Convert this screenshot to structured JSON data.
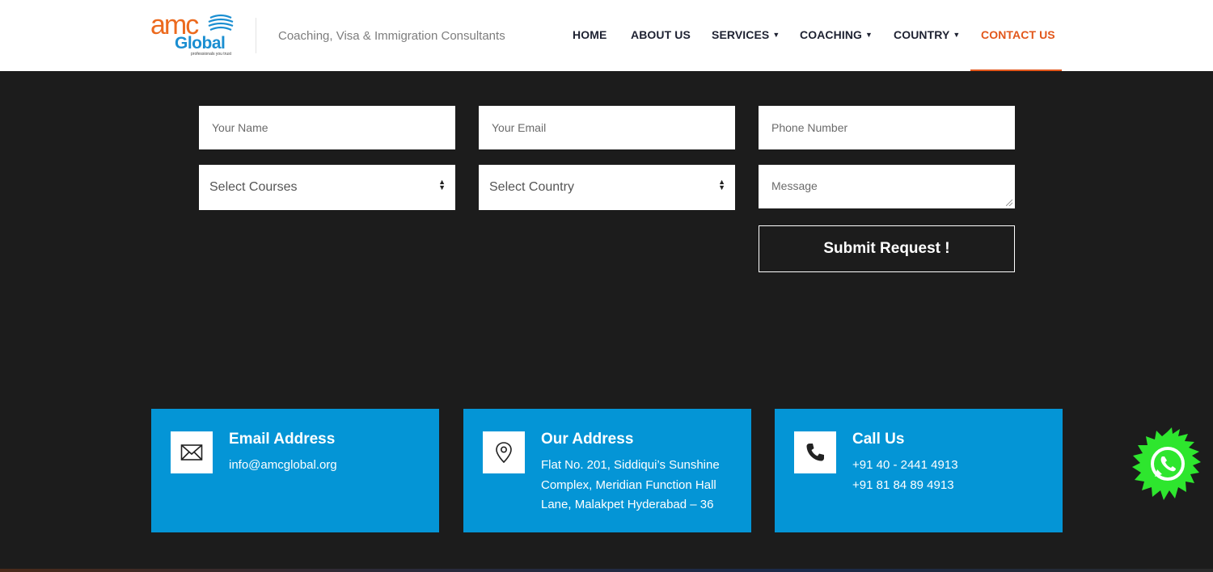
{
  "header": {
    "logo": {
      "brand_top": "amc",
      "brand_bottom": "Global",
      "tagline_small": "professionals you trust"
    },
    "tagline": "Coaching, Visa & Immigration Consultants",
    "nav": [
      {
        "label": "HOME",
        "dropdown": false,
        "active": false
      },
      {
        "label": "ABOUT US",
        "dropdown": false,
        "active": false
      },
      {
        "label": "SERVICES",
        "dropdown": true,
        "active": false
      },
      {
        "label": "COACHING",
        "dropdown": true,
        "active": false
      },
      {
        "label": "COUNTRY",
        "dropdown": true,
        "active": false
      },
      {
        "label": "CONTACT US",
        "dropdown": false,
        "active": true
      }
    ]
  },
  "form": {
    "name_placeholder": "Your Name",
    "email_placeholder": "Your Email",
    "phone_placeholder": "Phone Number",
    "courses_selected": "Select Courses",
    "country_selected": "Select Country",
    "message_placeholder": "Message",
    "submit_label": "Submit Request !"
  },
  "cards": {
    "email": {
      "title": "Email Address",
      "lines": [
        "info@amcglobal.org"
      ],
      "icon": "envelope-icon"
    },
    "address": {
      "title": "Our Address",
      "lines": [
        "Flat No. 201, Siddiqui’s Sunshine",
        "Complex, Meridian Function Hall",
        "Lane, Malakpet Hyderabad – 36"
      ],
      "icon": "map-pin-icon"
    },
    "call": {
      "title": "Call Us",
      "lines": [
        "+91 40 - 2441 4913",
        "+91 81 84 89 4913"
      ],
      "icon": "phone-icon"
    }
  },
  "floating": {
    "icon": "whatsapp-icon"
  },
  "colors": {
    "accent": "#e2571b",
    "card_bg": "#0495d6",
    "page_bg": "#1c1c1c",
    "nav_text": "#1e2232",
    "whatsapp_green": "#2ee62e"
  }
}
